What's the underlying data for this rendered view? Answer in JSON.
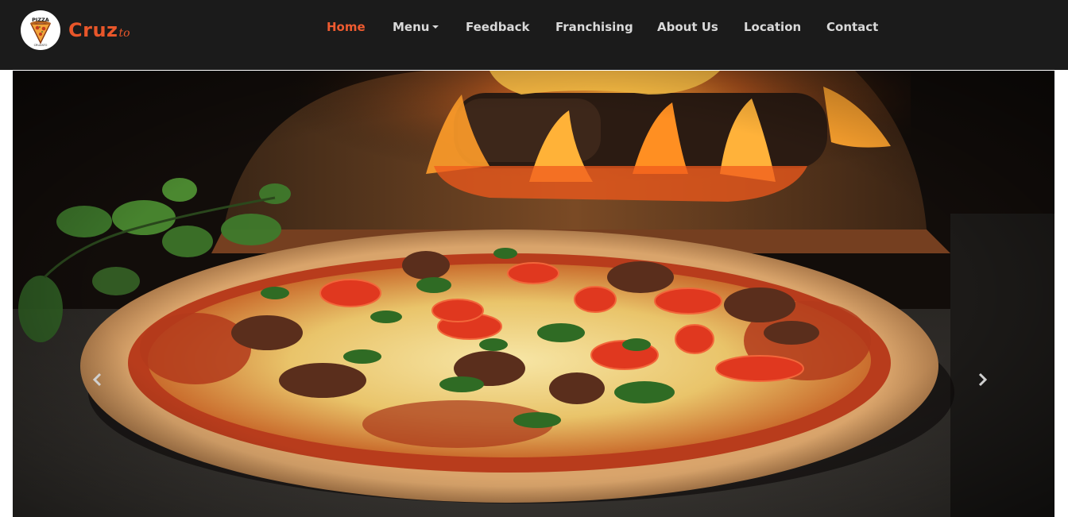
{
  "header": {
    "logo_icon": "pizza-logo",
    "logo_text": {
      "top": "PIZZA",
      "bottom": "CRUZATO"
    },
    "brand_main": "Cruz",
    "brand_script": "to",
    "accent_color": "#e8562a"
  },
  "nav": {
    "items": [
      {
        "label": "Home",
        "active": true
      },
      {
        "label": "Menu",
        "has_dropdown": true
      },
      {
        "label": "Feedback"
      },
      {
        "label": "Franchising"
      },
      {
        "label": "About Us"
      },
      {
        "label": "Location"
      },
      {
        "label": "Contact"
      }
    ]
  },
  "hero": {
    "image": "pizza-in-wood-fired-oven",
    "prev_icon": "chevron-left-icon",
    "next_icon": "chevron-right-icon"
  }
}
